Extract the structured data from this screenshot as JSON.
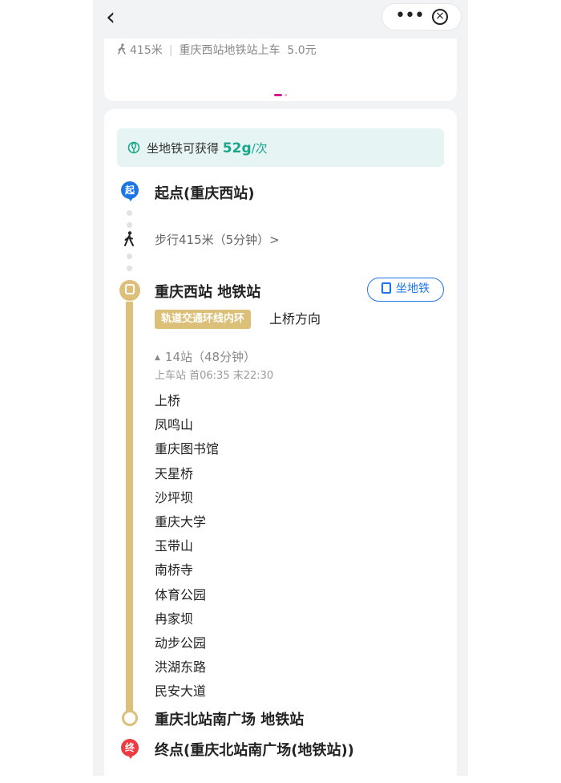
{
  "nav": {
    "back_glyph": "‹",
    "more_glyph": "•••",
    "close_glyph": "×"
  },
  "summary": {
    "walk_distance": "415米",
    "separator": "|",
    "boarding": "重庆西站地铁站上车",
    "fare": "5.0元"
  },
  "eco": {
    "text": "坐地铁可获得",
    "value": "52g",
    "unit": "/次"
  },
  "route": {
    "origin_badge": "起",
    "origin_label": "起点(重庆西站)",
    "walk_step": "步行415米（5分钟）>",
    "board_station": "重庆西站 地铁站",
    "take_metro_label": "坐地铁",
    "line_name": "轨道交通环线内环",
    "direction": "上桥方向",
    "stops_summary": "14站（48分钟）",
    "schedule": "上车站 首06:35 末22:30",
    "stops": [
      "上桥",
      "凤鸣山",
      "重庆图书馆",
      "天星桥",
      "沙坪坝",
      "重庆大学",
      "玉带山",
      "南桥寺",
      "体育公园",
      "冉家坝",
      "动步公园",
      "洪湖东路",
      "民安大道"
    ],
    "alight_station": "重庆北站南广场 地铁站",
    "dest_badge": "终",
    "dest_label": "终点(重庆北站南广场(地铁站))"
  },
  "colors": {
    "accent_blue": "#1d76e8",
    "metro_line": "#dcc07a",
    "eco_green": "#1aa68a",
    "dest_red": "#ee3b41",
    "page_indicator": "#d61a8a"
  },
  "icons": {
    "back": "back-chevron-icon",
    "more": "more-dots-icon",
    "close": "close-circle-icon",
    "walk": "walking-person-icon",
    "leaf": "leaf-icon",
    "metro": "metro-train-icon"
  }
}
